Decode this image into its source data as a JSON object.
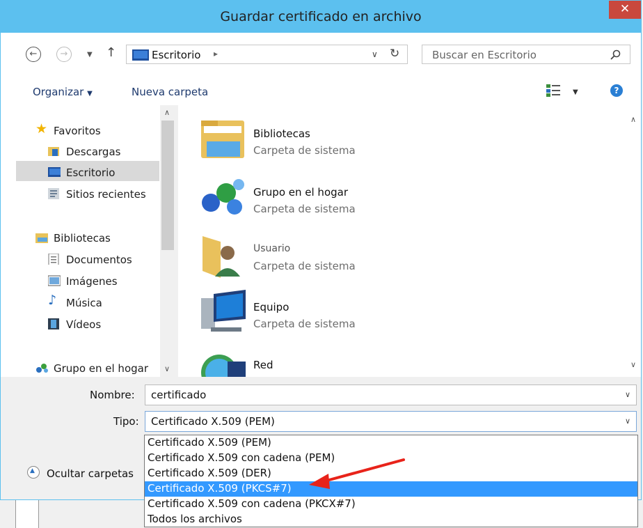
{
  "window": {
    "title": "Guardar certificado en archivo",
    "close_glyph": "✕"
  },
  "address": {
    "location": "Escritorio",
    "search_placeholder": "Buscar en Escritorio"
  },
  "toolbar": {
    "organize": "Organizar",
    "new_folder": "Nueva carpeta"
  },
  "sidebar": {
    "favorites": "Favoritos",
    "downloads": "Descargas",
    "desktop": "Escritorio",
    "recent": "Sitios recientes",
    "libraries": "Bibliotecas",
    "documents": "Documentos",
    "pictures": "Imágenes",
    "music": "Música",
    "videos": "Vídeos",
    "homegroup": "Grupo en el hogar"
  },
  "items": [
    {
      "name": "Bibliotecas",
      "type": "Carpeta de sistema",
      "icon": "library-folder-icon"
    },
    {
      "name": "Grupo en el hogar",
      "type": "Carpeta de sistema",
      "icon": "homegroup-icon"
    },
    {
      "name": "Usuario",
      "type": "Carpeta de sistema",
      "icon": "user-folder-icon"
    },
    {
      "name": "Equipo",
      "type": "Carpeta de sistema",
      "icon": "computer-icon"
    },
    {
      "name": "Red",
      "type": "",
      "icon": "network-icon"
    }
  ],
  "form": {
    "name_label": "Nombre:",
    "name_value": "certificado",
    "type_label": "Tipo:",
    "type_value": "Certificado X.509 (PEM)",
    "hide_folders": "Ocultar carpetas"
  },
  "dropdown_options": [
    "Certificado X.509 (PEM)",
    "Certificado X.509 con cadena (PEM)",
    "Certificado X.509 (DER)",
    "Certificado X.509 (PKCS#7)",
    "Certificado X.509 con cadena (PKCX#7)",
    "Todos los archivos"
  ],
  "highlighted_option_index": 3,
  "colors": {
    "titlebar": "#5cc0ef",
    "close": "#c9483d",
    "highlight": "#3399ff",
    "annotation_arrow": "#e8231a"
  }
}
